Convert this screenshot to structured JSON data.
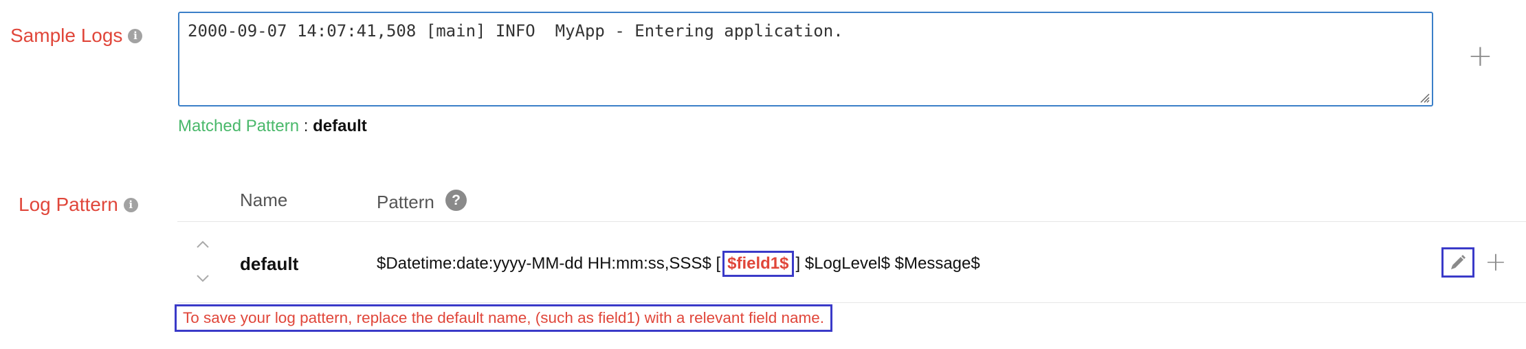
{
  "sample_logs": {
    "label": "Sample Logs",
    "value": "2000-09-07 14:07:41,508 [main] INFO  MyApp - Entering application.",
    "matched_label": "Matched Pattern",
    "matched_separator": " : ",
    "matched_value": "default"
  },
  "log_pattern": {
    "label": "Log Pattern",
    "columns": {
      "name": "Name",
      "pattern": "Pattern"
    },
    "rows": [
      {
        "name": "default",
        "pattern_before": "$Datetime:date:yyyy-MM-dd HH:mm:ss,SSS$ [",
        "pattern_highlight": "$field1$",
        "pattern_after": "] $LogLevel$ $Message$"
      }
    ],
    "warning": "To save your log pattern, replace the default name, (such as field1) with a relevant field name."
  },
  "icons": {
    "info": "info-icon",
    "help": "question-icon",
    "add": "plus-icon",
    "edit": "pencil-icon",
    "move_up": "chevron-up-icon",
    "move_down": "chevron-down-icon"
  },
  "colors": {
    "label_red": "#e0463a",
    "matched_green": "#49b86a",
    "focus_blue": "#3a7fc8",
    "highlight_box": "#3a3ac8"
  }
}
